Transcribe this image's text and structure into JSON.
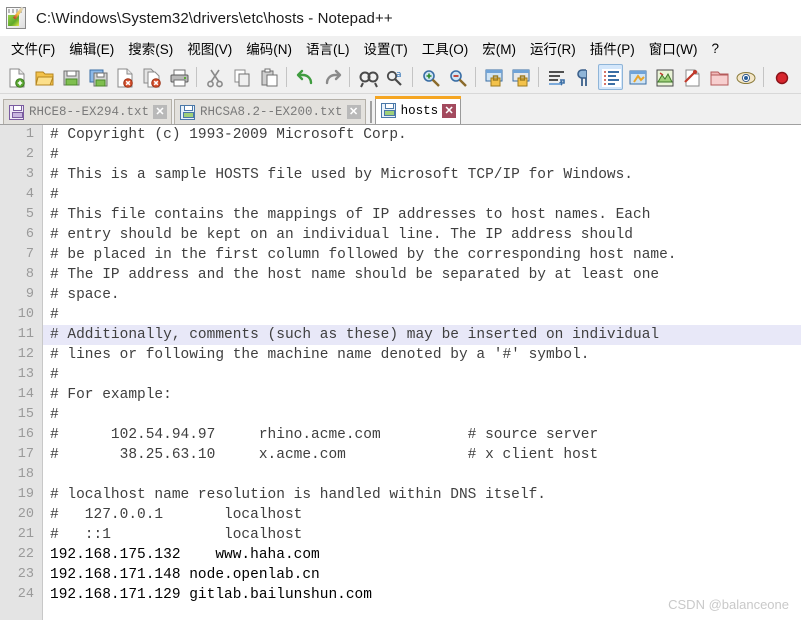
{
  "window": {
    "title": "C:\\Windows\\System32\\drivers\\etc\\hosts - Notepad++",
    "icon": "notepad-plus-plus-icon"
  },
  "menubar": {
    "items": [
      {
        "label": "文件(F)",
        "name": "menu-file"
      },
      {
        "label": "编辑(E)",
        "name": "menu-edit"
      },
      {
        "label": "搜索(S)",
        "name": "menu-search"
      },
      {
        "label": "视图(V)",
        "name": "menu-view"
      },
      {
        "label": "编码(N)",
        "name": "menu-encoding"
      },
      {
        "label": "语言(L)",
        "name": "menu-language"
      },
      {
        "label": "设置(T)",
        "name": "menu-settings"
      },
      {
        "label": "工具(O)",
        "name": "menu-tools"
      },
      {
        "label": "宏(M)",
        "name": "menu-macro"
      },
      {
        "label": "运行(R)",
        "name": "menu-run"
      },
      {
        "label": "插件(P)",
        "name": "menu-plugins"
      },
      {
        "label": "窗口(W)",
        "name": "menu-window"
      },
      {
        "label": "?",
        "name": "menu-help"
      }
    ]
  },
  "toolbar": {
    "buttons": [
      {
        "icon": "new-file-icon",
        "title": "新建"
      },
      {
        "icon": "open-file-icon",
        "title": "打开"
      },
      {
        "icon": "save-icon",
        "title": "保存"
      },
      {
        "icon": "save-all-icon",
        "title": "保存所有"
      },
      {
        "icon": "close-file-icon",
        "title": "关闭"
      },
      {
        "icon": "close-all-icon",
        "title": "关闭所有"
      },
      {
        "icon": "print-icon",
        "title": "打印"
      },
      {
        "icon": "separator"
      },
      {
        "icon": "cut-icon",
        "title": "剪切"
      },
      {
        "icon": "copy-icon",
        "title": "复制"
      },
      {
        "icon": "paste-icon",
        "title": "粘贴"
      },
      {
        "icon": "separator"
      },
      {
        "icon": "undo-icon",
        "title": "撤销"
      },
      {
        "icon": "redo-icon",
        "title": "重做"
      },
      {
        "icon": "separator"
      },
      {
        "icon": "find-icon",
        "title": "查找"
      },
      {
        "icon": "replace-icon",
        "title": "替换"
      },
      {
        "icon": "separator"
      },
      {
        "icon": "zoom-in-icon",
        "title": "放大"
      },
      {
        "icon": "zoom-out-icon",
        "title": "缩小"
      },
      {
        "icon": "separator"
      },
      {
        "icon": "sync-vertical-icon",
        "title": "同步垂直滚动"
      },
      {
        "icon": "sync-horizontal-icon",
        "title": "同步水平滚动"
      },
      {
        "icon": "separator"
      },
      {
        "icon": "word-wrap-icon",
        "title": "自动换行"
      },
      {
        "icon": "show-all-chars-icon",
        "title": "显示所有字符"
      },
      {
        "icon": "indent-guide-icon",
        "title": "显示缩进参考线",
        "active": true
      },
      {
        "icon": "user-defined-dialog-icon",
        "title": "用户自定义语言"
      },
      {
        "icon": "document-map-icon",
        "title": "文档地图"
      },
      {
        "icon": "function-list-icon",
        "title": "函数列表"
      },
      {
        "icon": "folder-workspace-icon",
        "title": "文件夹作为工作区"
      },
      {
        "icon": "monitoring-icon",
        "title": "监视文件"
      },
      {
        "icon": "separator"
      },
      {
        "icon": "macro-record-icon",
        "title": "录制宏"
      },
      {
        "icon": "macro-stop-icon",
        "title": "停止录制"
      }
    ]
  },
  "tabs": [
    {
      "label": "RHCE8--EX294.txt",
      "active": false,
      "icon": "saved-file-icon-purple",
      "close": "✕"
    },
    {
      "label": "RHCSA8.2--EX200.txt",
      "active": false,
      "icon": "saved-file-icon-blue",
      "close": "✕"
    },
    {
      "label": "hosts",
      "active": true,
      "icon": "saved-file-icon-green",
      "close": "✕"
    }
  ],
  "editor": {
    "language": "plain-text",
    "current_line": 11,
    "lines": [
      {
        "n": "1",
        "text": "# Copyright (c) 1993-2009 Microsoft Corp.",
        "comment": true
      },
      {
        "n": "2",
        "text": "#",
        "comment": true
      },
      {
        "n": "3",
        "text": "# This is a sample HOSTS file used by Microsoft TCP/IP for Windows.",
        "comment": true
      },
      {
        "n": "4",
        "text": "#",
        "comment": true
      },
      {
        "n": "5",
        "text": "# This file contains the mappings of IP addresses to host names. Each",
        "comment": true
      },
      {
        "n": "6",
        "text": "# entry should be kept on an individual line. The IP address should",
        "comment": true
      },
      {
        "n": "7",
        "text": "# be placed in the first column followed by the corresponding host name.",
        "comment": true
      },
      {
        "n": "8",
        "text": "# The IP address and the host name should be separated by at least one",
        "comment": true
      },
      {
        "n": "9",
        "text": "# space.",
        "comment": true
      },
      {
        "n": "10",
        "text": "#",
        "comment": true
      },
      {
        "n": "11",
        "text": "# Additionally, comments (such as these) may be inserted on individual",
        "comment": true
      },
      {
        "n": "12",
        "text": "# lines or following the machine name denoted by a '#' symbol.",
        "comment": true
      },
      {
        "n": "13",
        "text": "#",
        "comment": true
      },
      {
        "n": "14",
        "text": "# For example:",
        "comment": true
      },
      {
        "n": "15",
        "text": "#",
        "comment": true
      },
      {
        "n": "16",
        "text": "#      102.54.94.97     rhino.acme.com          # source server",
        "comment": true
      },
      {
        "n": "17",
        "text": "#       38.25.63.10     x.acme.com              # x client host",
        "comment": true
      },
      {
        "n": "18",
        "text": "",
        "comment": true
      },
      {
        "n": "19",
        "text": "# localhost name resolution is handled within DNS itself.",
        "comment": true
      },
      {
        "n": "20",
        "text": "#   127.0.0.1       localhost",
        "comment": true
      },
      {
        "n": "21",
        "text": "#   ::1             localhost",
        "comment": true
      },
      {
        "n": "22",
        "text": "192.168.175.132    www.haha.com",
        "comment": false
      },
      {
        "n": "23",
        "text": "192.168.171.148 node.openlab.cn",
        "comment": false
      },
      {
        "n": "24",
        "text": "192.168.171.129 gitlab.bailunshun.com",
        "comment": false
      }
    ]
  },
  "watermark": {
    "text": "CSDN @balanceone"
  },
  "colors": {
    "accent_tab": "#f5a623",
    "current_line_bg": "#e8e8f8",
    "gutter_bg": "#e4e4e4",
    "close_active": "#a34a5e"
  }
}
